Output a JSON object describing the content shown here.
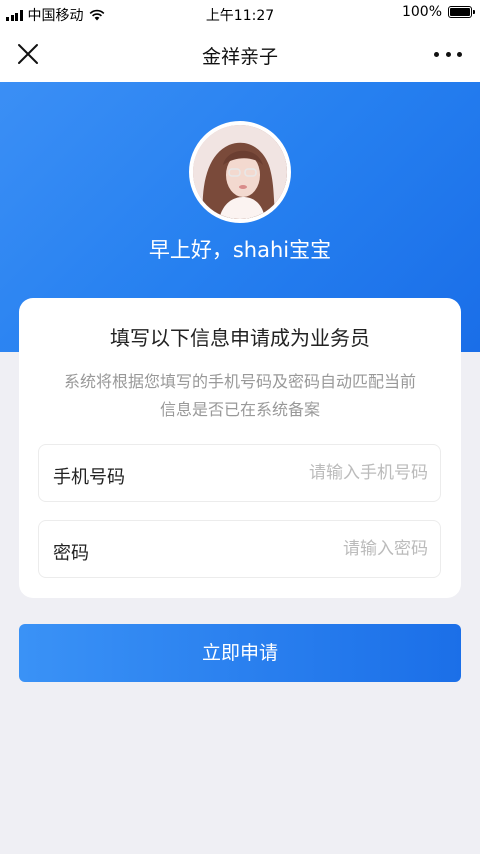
{
  "status": {
    "carrier": "中国移动",
    "time": "上午11:27",
    "battery": "100%",
    "battery_level": 1.0
  },
  "nav": {
    "title": "金祥亲子"
  },
  "profile": {
    "greeting": "早上好，shahi宝宝"
  },
  "card": {
    "title": "填写以下信息申请成为业务员",
    "description": "系统将根据您填写的手机号码及密码自动匹配当前信息是否已在系统备案"
  },
  "form": {
    "phone": {
      "label": "手机号码",
      "placeholder": "请输入手机号码",
      "value": ""
    },
    "password": {
      "label": "密码",
      "placeholder": "请输入密码",
      "value": ""
    }
  },
  "actions": {
    "submit_label": "立即申请"
  },
  "colors": {
    "primary": "#2680f0",
    "background": "#efeff4",
    "placeholder": "#bbbbbb"
  }
}
